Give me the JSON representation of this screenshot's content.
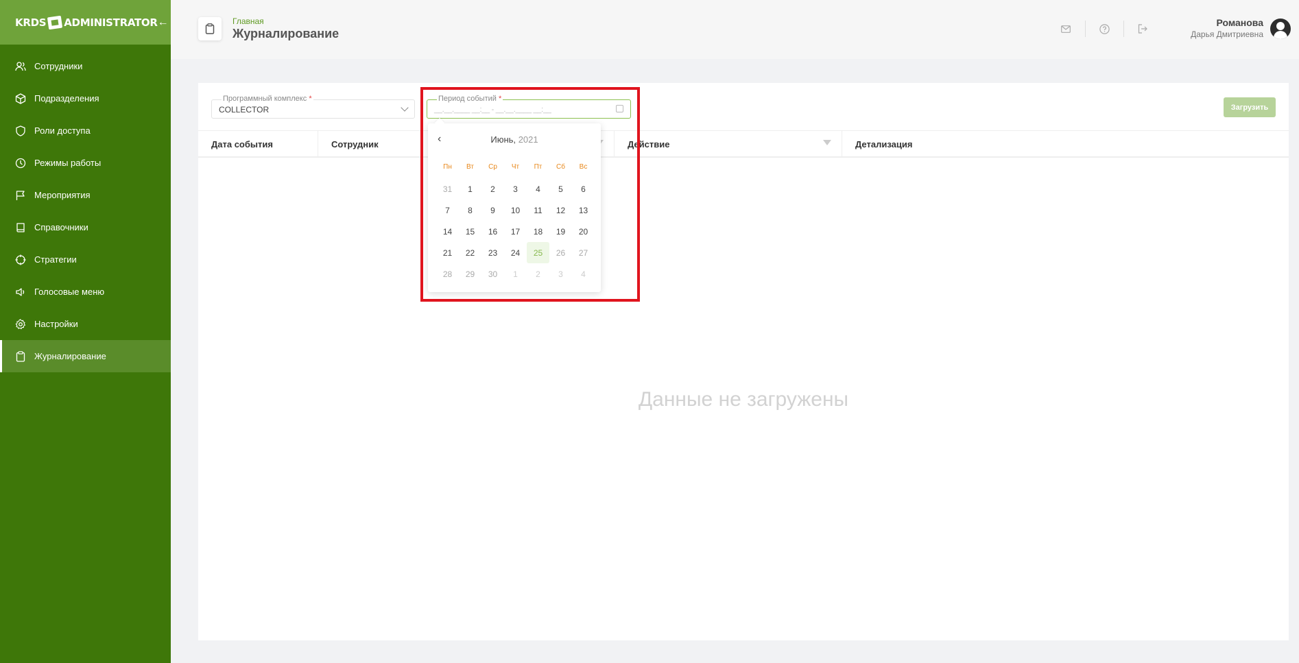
{
  "app": {
    "logo_left": "KRDS",
    "logo_right": "ADMINISTRATOR"
  },
  "sidebar": {
    "items": [
      {
        "label": "Сотрудники",
        "icon": "users-icon"
      },
      {
        "label": "Подразделения",
        "icon": "cube-icon"
      },
      {
        "label": "Роли доступа",
        "icon": "shield-icon"
      },
      {
        "label": "Режимы работы",
        "icon": "clock-icon"
      },
      {
        "label": "Мероприятия",
        "icon": "flag-icon"
      },
      {
        "label": "Справочники",
        "icon": "book-icon"
      },
      {
        "label": "Стратегии",
        "icon": "target-icon"
      },
      {
        "label": "Голосовые меню",
        "icon": "speaker-icon"
      },
      {
        "label": "Настройки",
        "icon": "gear-icon"
      },
      {
        "label": "Журналирование",
        "icon": "clipboard-icon",
        "active": true
      }
    ]
  },
  "header": {
    "breadcrumb": "Главная",
    "title": "Журналирование",
    "user": {
      "last_name": "Романова",
      "first_names": "Дарья Дмитриевна"
    }
  },
  "filters": {
    "system_label": "Программный комплекс",
    "system_value": "COLLECTOR",
    "period_label": "Период событий",
    "period_mask": "__.__.____ __:__ - __.__.____ __:__",
    "required_mark": "*",
    "load_button": "Загрузить"
  },
  "table": {
    "columns": [
      "Дата события",
      "Сотрудник",
      "Действие",
      "Детализация"
    ],
    "empty_text": "Данные не загружены"
  },
  "calendar": {
    "prev": "‹",
    "month": "Июнь,",
    "year": "2021",
    "weekdays": [
      "Пн",
      "Вт",
      "Ср",
      "Чт",
      "Пт",
      "Сб",
      "Вс"
    ],
    "days": [
      {
        "d": "31",
        "s": "muted"
      },
      {
        "d": "1"
      },
      {
        "d": "2"
      },
      {
        "d": "3"
      },
      {
        "d": "4"
      },
      {
        "d": "5"
      },
      {
        "d": "6"
      },
      {
        "d": "7"
      },
      {
        "d": "8"
      },
      {
        "d": "9"
      },
      {
        "d": "10"
      },
      {
        "d": "11"
      },
      {
        "d": "12"
      },
      {
        "d": "13"
      },
      {
        "d": "14"
      },
      {
        "d": "15"
      },
      {
        "d": "16"
      },
      {
        "d": "17"
      },
      {
        "d": "18"
      },
      {
        "d": "19"
      },
      {
        "d": "20"
      },
      {
        "d": "21"
      },
      {
        "d": "22"
      },
      {
        "d": "23"
      },
      {
        "d": "24"
      },
      {
        "d": "25",
        "s": "today"
      },
      {
        "d": "26",
        "s": "muted"
      },
      {
        "d": "27",
        "s": "muted"
      },
      {
        "d": "28",
        "s": "muted"
      },
      {
        "d": "29",
        "s": "muted"
      },
      {
        "d": "30",
        "s": "muted"
      },
      {
        "d": "1",
        "s": "faint"
      },
      {
        "d": "2",
        "s": "faint"
      },
      {
        "d": "3",
        "s": "faint"
      },
      {
        "d": "4",
        "s": "faint"
      }
    ]
  },
  "colors": {
    "sidebar": "#3e7709",
    "sidebar_head": "#6fa33a",
    "accent": "#5f9a23",
    "highlight": "#e0141e"
  }
}
